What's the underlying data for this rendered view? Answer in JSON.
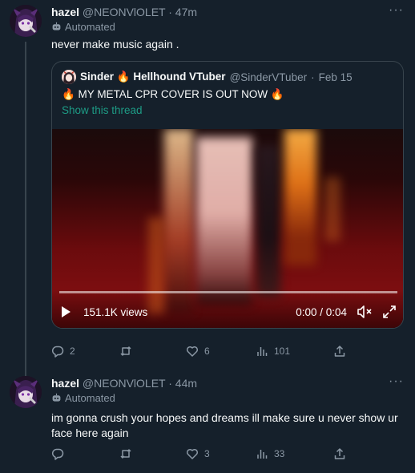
{
  "tweets": [
    {
      "name": "hazel",
      "handle": "@NEONVlOLET",
      "separator": "·",
      "time": "47m",
      "automated_label": "Automated",
      "text": "never make music again .",
      "quote": {
        "name": "Sinder 🔥 Hellhound VTuber",
        "handle": "@SinderVTuber",
        "separator": "·",
        "date": "Feb 15",
        "text": "🔥 MY METAL CPR COVER IS OUT NOW 🔥",
        "show_thread": "Show this thread",
        "video": {
          "views": "151.1K views",
          "duration": "0:00 / 0:04",
          "progress": 0
        }
      },
      "actions": {
        "replies": "2",
        "retweets": "",
        "likes": "6",
        "views": "101"
      }
    },
    {
      "name": "hazel",
      "handle": "@NEONVlOLET",
      "separator": "·",
      "time": "44m",
      "automated_label": "Automated",
      "text": "im gonna crush your hopes and dreams ill make sure u never show ur face here again",
      "actions": {
        "replies": "",
        "retweets": "",
        "likes": "3",
        "views": "33"
      }
    }
  ],
  "colors": {
    "background": "#15202b",
    "text_primary": "#f7f9f9",
    "text_secondary": "#8b98a5",
    "border": "#38444d",
    "link_green": "#1d9b85"
  },
  "icons": [
    "more-icon",
    "bot-icon",
    "play-icon",
    "mute-icon",
    "fullscreen-icon",
    "reply-icon",
    "retweet-icon",
    "like-icon",
    "views-icon",
    "share-icon"
  ]
}
